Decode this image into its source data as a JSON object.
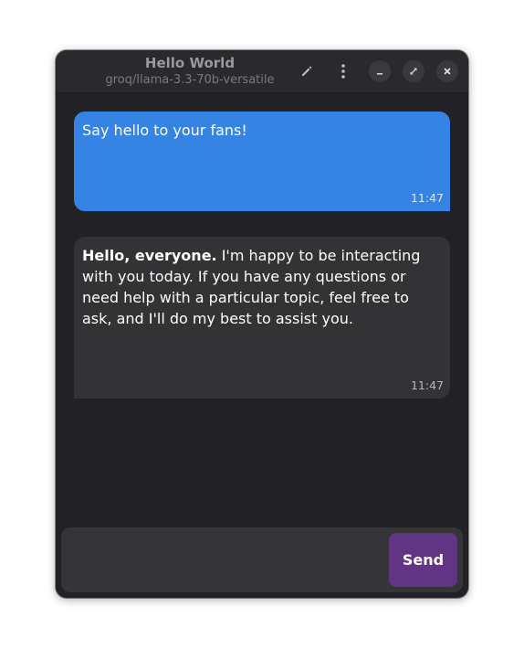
{
  "window": {
    "title": "Hello World",
    "subtitle": "groq/llama-3.3-70b-versatile"
  },
  "header_buttons": [
    {
      "name": "edit-button",
      "icon": "pencil-icon"
    },
    {
      "name": "menu-button",
      "icon": "vertical-ellipsis-icon"
    },
    {
      "name": "minimize-button",
      "icon": "minimize-icon"
    },
    {
      "name": "maximize-button",
      "icon": "maximize-icon"
    },
    {
      "name": "close-button",
      "icon": "close-icon"
    }
  ],
  "messages": [
    {
      "role": "user",
      "text": "Say hello to your fans!",
      "time": "11:47"
    },
    {
      "role": "assistant",
      "bold_text": "Hello, everyone.",
      "text": " I'm happy to be interacting with you today. If you have any questions or need help with a particular topic, feel free to ask, and I'll do my best to assist you.",
      "time": "11:47"
    }
  ],
  "composer": {
    "value": "",
    "send_label": "Send"
  },
  "colors": {
    "window_bg": "#222226",
    "header_bg": "#2a2a2e",
    "user_bubble": "#3584e4",
    "assistant_bubble": "#333336",
    "send_button": "#613583"
  }
}
